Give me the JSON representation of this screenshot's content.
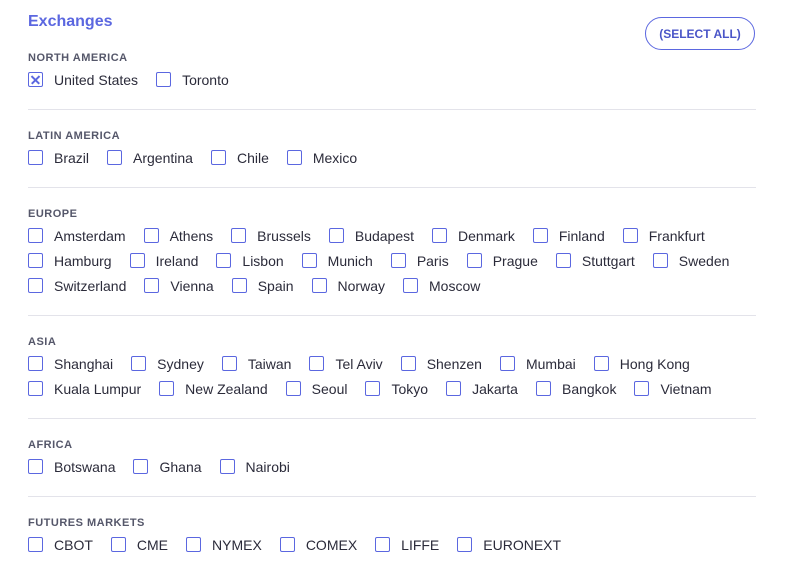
{
  "header": {
    "title": "Exchanges",
    "select_all_label": "(SELECT ALL)"
  },
  "colors": {
    "accent": "#5b67e0",
    "text": "#2b2b3a",
    "divider": "#e3e3ea"
  },
  "sections": [
    {
      "title": "NORTH AMERICA",
      "items": [
        {
          "label": "United States",
          "checked": true
        },
        {
          "label": "Toronto",
          "checked": false
        }
      ]
    },
    {
      "title": "LATIN AMERICA",
      "items": [
        {
          "label": "Brazil",
          "checked": false
        },
        {
          "label": "Argentina",
          "checked": false
        },
        {
          "label": "Chile",
          "checked": false
        },
        {
          "label": "Mexico",
          "checked": false
        }
      ]
    },
    {
      "title": "EUROPE",
      "items": [
        {
          "label": "Amsterdam",
          "checked": false
        },
        {
          "label": "Athens",
          "checked": false
        },
        {
          "label": "Brussels",
          "checked": false
        },
        {
          "label": "Budapest",
          "checked": false
        },
        {
          "label": "Denmark",
          "checked": false
        },
        {
          "label": "Finland",
          "checked": false
        },
        {
          "label": "Frankfurt",
          "checked": false
        },
        {
          "label": "Hamburg",
          "checked": false
        },
        {
          "label": "Ireland",
          "checked": false
        },
        {
          "label": "Lisbon",
          "checked": false
        },
        {
          "label": "Munich",
          "checked": false
        },
        {
          "label": "Paris",
          "checked": false
        },
        {
          "label": "Prague",
          "checked": false
        },
        {
          "label": "Stuttgart",
          "checked": false
        },
        {
          "label": "Sweden",
          "checked": false
        },
        {
          "label": "Switzerland",
          "checked": false
        },
        {
          "label": "Vienna",
          "checked": false
        },
        {
          "label": "Spain",
          "checked": false
        },
        {
          "label": "Norway",
          "checked": false
        },
        {
          "label": "Moscow",
          "checked": false
        }
      ]
    },
    {
      "title": "ASIA",
      "items": [
        {
          "label": "Shanghai",
          "checked": false
        },
        {
          "label": "Sydney",
          "checked": false
        },
        {
          "label": "Taiwan",
          "checked": false
        },
        {
          "label": "Tel Aviv",
          "checked": false
        },
        {
          "label": "Shenzen",
          "checked": false
        },
        {
          "label": "Mumbai",
          "checked": false
        },
        {
          "label": "Hong Kong",
          "checked": false
        },
        {
          "label": "Kuala Lumpur",
          "checked": false
        },
        {
          "label": "New Zealand",
          "checked": false
        },
        {
          "label": "Seoul",
          "checked": false
        },
        {
          "label": "Tokyo",
          "checked": false
        },
        {
          "label": "Jakarta",
          "checked": false
        },
        {
          "label": "Bangkok",
          "checked": false
        },
        {
          "label": "Vietnam",
          "checked": false
        }
      ]
    },
    {
      "title": "AFRICA",
      "items": [
        {
          "label": "Botswana",
          "checked": false
        },
        {
          "label": "Ghana",
          "checked": false
        },
        {
          "label": "Nairobi",
          "checked": false
        }
      ]
    },
    {
      "title": "FUTURES MARKETS",
      "items": [
        {
          "label": "CBOT",
          "checked": false
        },
        {
          "label": "CME",
          "checked": false
        },
        {
          "label": "NYMEX",
          "checked": false
        },
        {
          "label": "COMEX",
          "checked": false
        },
        {
          "label": "LIFFE",
          "checked": false
        },
        {
          "label": "EURONEXT",
          "checked": false
        }
      ]
    }
  ]
}
